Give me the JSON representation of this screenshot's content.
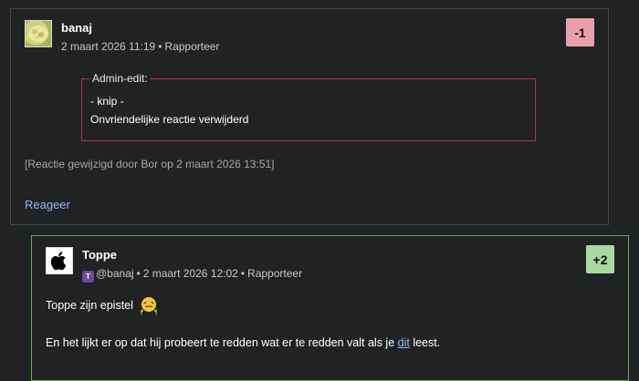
{
  "comments": [
    {
      "author": "banaj",
      "avatar": "user-photo-avatar",
      "date": "2 maart 2026 11:19",
      "report_label": "Rapporteer",
      "score": "-1",
      "score_color": "#e8a0ab",
      "admin_edit": {
        "legend": "Admin-edit:",
        "line1": "- knip -",
        "line2": "Onvriendelijke reactie verwijderd"
      },
      "edited_note": "[Reactie gewijzigd door Bor op 2 maart 2026 13:51]",
      "reply_label": "Reageer"
    },
    {
      "author": "Toppe",
      "avatar": "apple-logo-avatar",
      "mention": "@banaj",
      "date": "2 maart 2026 12:02",
      "report_label": "Rapporteer",
      "score": "+2",
      "score_color": "#a8d99e",
      "line1_text": "Toppe zijn epistel",
      "line1_emoji": "nauseated-face-emoji",
      "line2_before": "En het lijkt er op dat hij probeert te redden wat er te redden valt als je ",
      "line2_link": "dit",
      "line2_after": " leest."
    }
  ],
  "colors": {
    "background": "#212224",
    "border_default": "#45474b",
    "border_positive": "#6aa84f",
    "admin_border": "#b2334d",
    "link": "#8fb8e8"
  }
}
